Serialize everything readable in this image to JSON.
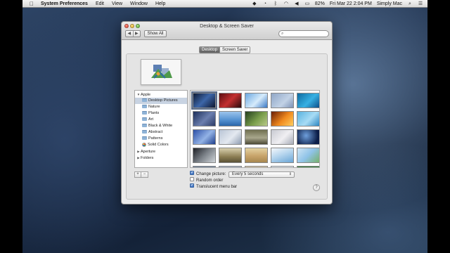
{
  "menubar": {
    "apple_icon": "apple-icon",
    "app_name": "System Preferences",
    "menus": [
      "Edit",
      "View",
      "Window",
      "Help"
    ],
    "battery": "82%",
    "clock": "Fri Mar 22  2:04 PM",
    "user": "Simply Mac"
  },
  "window": {
    "title": "Desktop & Screen Saver",
    "back_glyph": "◀",
    "forward_glyph": "▶",
    "show_all_label": "Show All",
    "search_placeholder": ""
  },
  "tabs": [
    {
      "label": "Desktop",
      "selected": true
    },
    {
      "label": "Screen Saver",
      "selected": false
    }
  ],
  "sidebar": {
    "items": [
      {
        "label": "Apple",
        "level": 0,
        "expanded": true,
        "icon": "disclosure-down-icon"
      },
      {
        "label": "Desktop Pictures",
        "level": 1,
        "selected": true,
        "icon": "folder-icon"
      },
      {
        "label": "Nature",
        "level": 1,
        "icon": "folder-icon"
      },
      {
        "label": "Plants",
        "level": 1,
        "icon": "folder-icon"
      },
      {
        "label": "Art",
        "level": 1,
        "icon": "folder-icon"
      },
      {
        "label": "Black & White",
        "level": 1,
        "icon": "folder-icon"
      },
      {
        "label": "Abstract",
        "level": 1,
        "icon": "folder-icon"
      },
      {
        "label": "Patterns",
        "level": 1,
        "icon": "folder-icon"
      },
      {
        "label": "Solid Colors",
        "level": 1,
        "icon": "color-wheel-icon"
      },
      {
        "label": "Aperture",
        "level": 0,
        "expanded": false,
        "icon": "disclosure-right-icon"
      },
      {
        "label": "Folders",
        "level": 0,
        "expanded": false,
        "icon": "disclosure-right-icon"
      }
    ],
    "add_label": "+",
    "remove_label": "−"
  },
  "options": {
    "change_picture_label": "Change picture:",
    "change_picture_checked": true,
    "interval_value": "Every 5 seconds",
    "random_order_label": "Random order",
    "random_order_checked": false,
    "translucent_label": "Translucent menu bar",
    "translucent_checked": true,
    "help_label": "?"
  },
  "thumbnails": [
    {
      "bg": "linear-gradient(135deg,#0d1a35,#3d66a8 50%,#0c1630)"
    },
    {
      "bg": "linear-gradient(135deg,#5a0c10,#c33030 50%,#2a0a0c)"
    },
    {
      "bg": "linear-gradient(135deg,#6aa7e0,#d6ebfb 55%,#3977c4)"
    },
    {
      "bg": "linear-gradient(135deg,#8fa6c6,#c2d2e6 60%,#7d92b5)"
    },
    {
      "bg": "linear-gradient(135deg,#0e6aa0,#38b1e3 55%,#0b4f8a)"
    },
    {
      "bg": "linear-gradient(135deg,#1c2e5a,#6c7fae 55%,#2c3b66)"
    },
    {
      "bg": "linear-gradient(180deg,#9cc4ec,#5895d3 55%,#2a66aa)"
    },
    {
      "bg": "linear-gradient(135deg,#243f1e,#7a9e4c 55%,#b9c98a)"
    },
    {
      "bg": "linear-gradient(135deg,#6a1e06,#f08a1e 55%,#ffcf60)"
    },
    {
      "bg": "linear-gradient(135deg,#5ab3e0,#a7dcf5 55%,#2c86c2)"
    },
    {
      "bg": "linear-gradient(135deg,#2c4fa6,#93b3e6 55%,#1e3e8c)"
    },
    {
      "bg": "linear-gradient(135deg,#b9c5d6,#e4e9f0 55%,#8f9db2)"
    },
    {
      "bg": "linear-gradient(180deg,#707050,#a8a68c 55%,#4c4a36)"
    },
    {
      "bg": "linear-gradient(135deg,#c8cad2,#f0eff2 55%,#a7acb8)"
    },
    {
      "bg": "radial-gradient(circle at 40% 40%,#6e9fdc,#0c1e48 75%)"
    },
    {
      "bg": "linear-gradient(135deg,#1e2026,#7b8188 50%,#cfd4d8)"
    },
    {
      "bg": "linear-gradient(180deg,#d8cfae,#8b7d52 60%,#5b5236)"
    },
    {
      "bg": "linear-gradient(180deg,#e3d2a0,#c7a36a 55%,#a6874e)"
    },
    {
      "bg": "linear-gradient(160deg,#f4f7fb,#b7d6ee 45%,#6aa6d6)"
    },
    {
      "bg": "linear-gradient(135deg,#cfe5f4,#8fc3e8 50%,#77b06a)"
    },
    {
      "bg": "linear-gradient(180deg,#6a7f9a,#c8ced8)"
    },
    {
      "bg": "linear-gradient(180deg,#a9b6c9,#e7ebf1)"
    },
    {
      "bg": "linear-gradient(180deg,#d9c9a8,#f0e6cf)"
    },
    {
      "bg": "linear-gradient(180deg,#e6eef6,#b6cfe6)"
    },
    {
      "bg": "linear-gradient(180deg,#2f7a35,#7ec36a)"
    }
  ]
}
